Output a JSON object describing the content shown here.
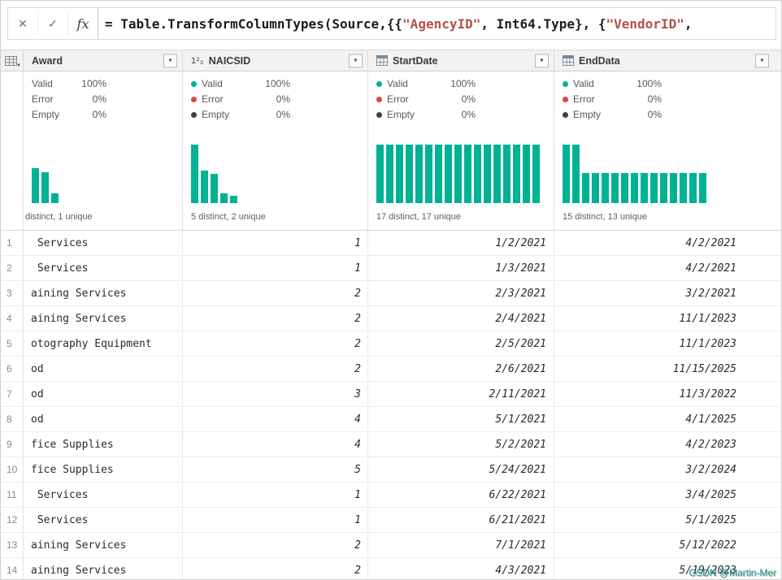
{
  "colors": {
    "accent_teal": "#00b294",
    "error_red": "#e04444",
    "empty_dark": "#3f3f3f",
    "string_red": "#b5504a"
  },
  "icons": {
    "dropdown": "▼",
    "whole_number": "1²₃"
  },
  "formula_bar": {
    "cancel_icon": "✕",
    "check_icon": "✓",
    "fx_label": "fx",
    "segments": [
      {
        "text": "= Table.TransformColumnTypes(Source,{{",
        "style": "plain"
      },
      {
        "text": "\"AgencyID\"",
        "style": "string"
      },
      {
        "text": ", Int64.Type}, {",
        "style": "plain"
      },
      {
        "text": "\"VendorID\"",
        "style": "string"
      },
      {
        "text": ",",
        "style": "plain"
      }
    ]
  },
  "quality_labels": {
    "valid": "Valid",
    "error": "Error",
    "empty": "Empty"
  },
  "columns": [
    {
      "name": "Award",
      "type": "text-clipped",
      "valid": "100%",
      "error": "0%",
      "empty": "0%",
      "show_dots": false,
      "bars": [
        0.6,
        0.53,
        0.16
      ],
      "distinct": "distinct, 1 unique"
    },
    {
      "name": "NAICSID",
      "type": "number",
      "valid": "100%",
      "error": "0%",
      "empty": "0%",
      "show_dots": true,
      "bars": [
        1.0,
        0.55,
        0.5,
        0.17,
        0.13
      ],
      "distinct": "5 distinct, 2 unique"
    },
    {
      "name": "StartDate",
      "type": "date",
      "valid": "100%",
      "error": "0%",
      "empty": "0%",
      "show_dots": true,
      "bars": [
        1,
        1,
        1,
        1,
        1,
        1,
        1,
        1,
        1,
        1,
        1,
        1,
        1,
        1,
        1,
        1,
        1
      ],
      "distinct": "17 distinct, 17 unique"
    },
    {
      "name": "EndData",
      "type": "date",
      "valid": "100%",
      "error": "0%",
      "empty": "0%",
      "show_dots": true,
      "bars": [
        1,
        1,
        0.52,
        0.52,
        0.52,
        0.52,
        0.52,
        0.52,
        0.52,
        0.52,
        0.52,
        0.52,
        0.52,
        0.52,
        0.52
      ],
      "distinct": "15 distinct, 13 unique"
    }
  ],
  "rows": [
    {
      "n": "1",
      "cells": [
        " Services",
        "1",
        "1/2/2021",
        "4/2/2021"
      ]
    },
    {
      "n": "2",
      "cells": [
        " Services",
        "1",
        "1/3/2021",
        "4/2/2021"
      ]
    },
    {
      "n": "3",
      "cells": [
        "aining Services",
        "2",
        "2/3/2021",
        "3/2/2021"
      ]
    },
    {
      "n": "4",
      "cells": [
        "aining Services",
        "2",
        "2/4/2021",
        "11/1/2023"
      ]
    },
    {
      "n": "5",
      "cells": [
        "otography Equipment",
        "2",
        "2/5/2021",
        "11/1/2023"
      ]
    },
    {
      "n": "6",
      "cells": [
        "od",
        "2",
        "2/6/2021",
        "11/15/2025"
      ]
    },
    {
      "n": "7",
      "cells": [
        "od",
        "3",
        "2/11/2021",
        "11/3/2022"
      ]
    },
    {
      "n": "8",
      "cells": [
        "od",
        "4",
        "5/1/2021",
        "4/1/2025"
      ]
    },
    {
      "n": "9",
      "cells": [
        "fice Supplies",
        "4",
        "5/2/2021",
        "4/2/2023"
      ]
    },
    {
      "n": "10",
      "cells": [
        "fice Supplies",
        "5",
        "5/24/2021",
        "3/2/2024"
      ]
    },
    {
      "n": "11",
      "cells": [
        " Services",
        "1",
        "6/22/2021",
        "3/4/2025"
      ]
    },
    {
      "n": "12",
      "cells": [
        " Services",
        "1",
        "6/21/2021",
        "5/1/2025"
      ]
    },
    {
      "n": "13",
      "cells": [
        "aining Services",
        "2",
        "7/1/2021",
        "5/12/2022"
      ]
    },
    {
      "n": "14",
      "cells": [
        "aining Services",
        "2",
        "4/3/2021",
        "5/19/2023"
      ]
    }
  ],
  "watermark": "CSDN @Martin-Mer"
}
